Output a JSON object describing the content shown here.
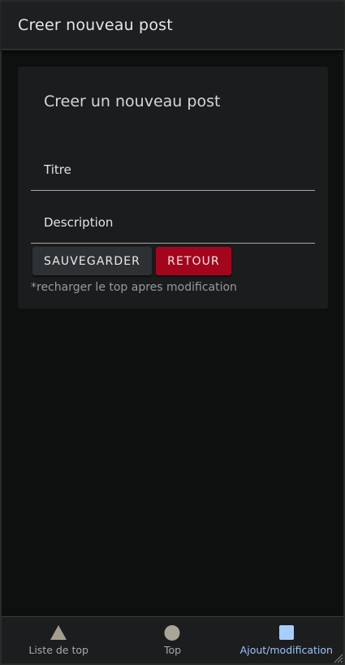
{
  "app_bar": {
    "title": "Creer nouveau post"
  },
  "form": {
    "heading": "Creer un nouveau post",
    "title_field": {
      "placeholder": "Titre",
      "value": ""
    },
    "description_field": {
      "placeholder": "Description",
      "value": ""
    },
    "save_label": "SAUVEGARDER",
    "back_label": "RETOUR",
    "note": "*recharger le top apres modification"
  },
  "bottom_nav": {
    "items": [
      {
        "label": "Liste de top",
        "icon": "triangle-icon"
      },
      {
        "label": "Top",
        "icon": "circle-icon"
      },
      {
        "label": "Ajout/modification",
        "icon": "square-icon",
        "active": true
      }
    ]
  },
  "colors": {
    "background": "#0e1010",
    "surface": "#1b1c1e",
    "primary_button": "#2e3133",
    "danger_button": "#a3051c",
    "active_nav": "#9cc5f7",
    "nav_icon": "#a39e8f"
  }
}
